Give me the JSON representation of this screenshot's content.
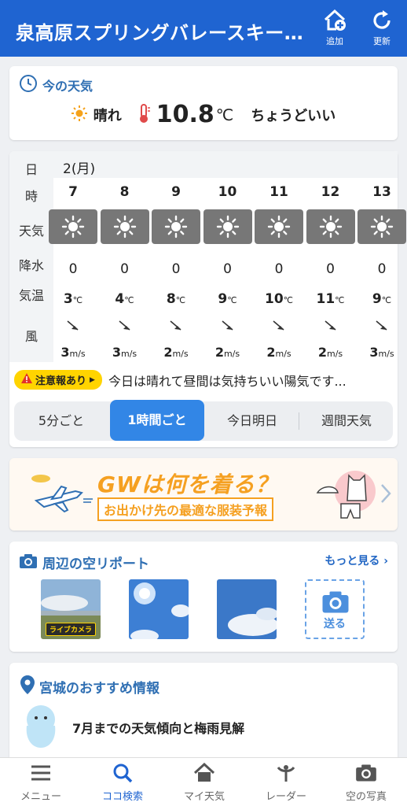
{
  "header": {
    "title": "泉高原スプリングバレースキー…",
    "add_label": "追加",
    "refresh_label": "更新"
  },
  "current": {
    "heading": "今の天気",
    "condition": "晴れ",
    "temperature": "10.8",
    "unit": "℃",
    "feeling": "ちょうどいい"
  },
  "hourly": {
    "labels": {
      "day": "日",
      "hour": "時",
      "weather": "天気",
      "precip": "降水",
      "temp": "気温",
      "wind": "風"
    },
    "date": "2(月)",
    "hours": [
      "7",
      "8",
      "9",
      "10",
      "11",
      "12",
      "13"
    ],
    "precip": [
      "0",
      "0",
      "0",
      "0",
      "0",
      "0",
      "0"
    ],
    "temps": [
      "3",
      "4",
      "8",
      "9",
      "10",
      "11",
      "9"
    ],
    "temp_unit": "℃",
    "wind_speeds": [
      "3",
      "3",
      "2",
      "2",
      "2",
      "2",
      "3"
    ],
    "wind_unit": "m/s",
    "weather_icon": "sun-icon"
  },
  "notice": {
    "badge": "注意報あり",
    "message": "今日は晴れて昼間は気持ちいい陽気です..."
  },
  "segments": {
    "five_min": "5分ごと",
    "hourly": "1時間ごと",
    "today_tomorrow": "今日明日",
    "weekly": "週間天気"
  },
  "banner": {
    "headline": "GWは何を着る？",
    "subline": "お出かけ先の最適な服装予報"
  },
  "sky_report": {
    "heading": "周辺の空リポート",
    "more": "もっと見る",
    "live_cam": "ライブカメラ",
    "send": "送る"
  },
  "recommend": {
    "heading": "宮城のおすすめ情報",
    "item": "7月までの天気傾向と梅雨見解"
  },
  "nav": {
    "menu": "メニュー",
    "here": "ココ検索",
    "my_weather": "マイ天気",
    "radar": "レーダー",
    "sky_photo": "空の写真"
  },
  "colors": {
    "primary": "#1f64d1",
    "accent": "#3286e6",
    "notice": "#ffd400",
    "banner": "#f5a021"
  }
}
